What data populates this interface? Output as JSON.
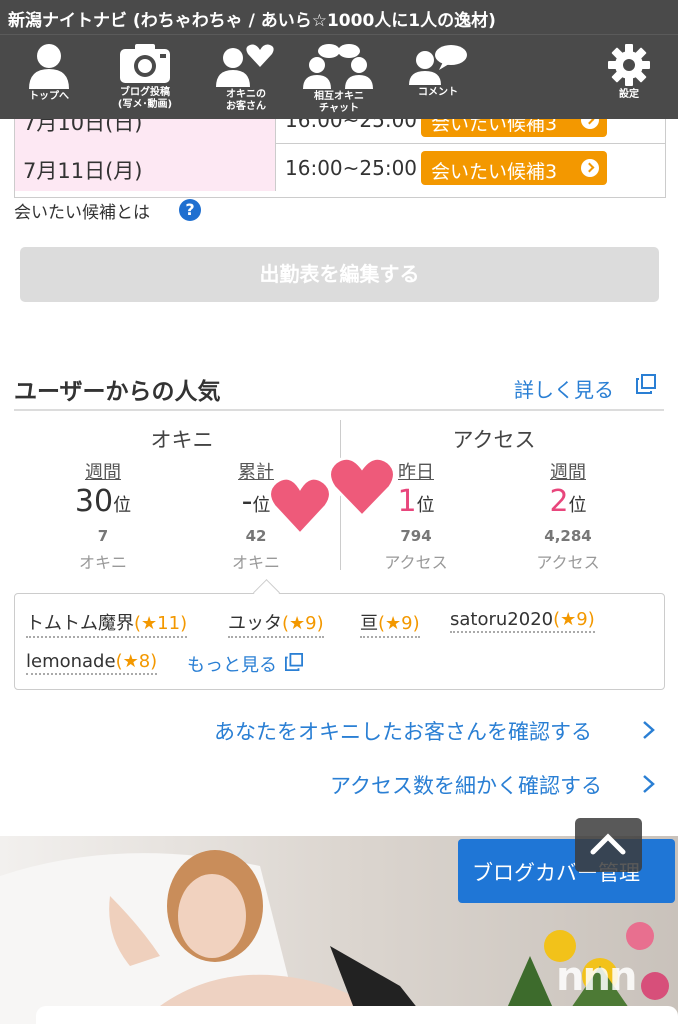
{
  "header": {
    "title": "新潟ナイトナビ (わちゃわちゃ / あいら☆1000人に1人の逸材)"
  },
  "nav": [
    {
      "label": "トップへ",
      "icon": "person-icon"
    },
    {
      "label": "ブログ投稿\n(写メ･動画)",
      "icon": "camera-icon"
    },
    {
      "label": "オキニの\nお客さん",
      "icon": "heart-people-icon"
    },
    {
      "label": "相互オキニ\nチャット",
      "icon": "chat-people-icon"
    },
    {
      "label": "コメント",
      "icon": "comment-icon"
    },
    {
      "label": "設定",
      "icon": "gear-icon"
    }
  ],
  "schedule": {
    "rows": [
      {
        "date": "7月10日(日)",
        "time": "16:00~25:00",
        "button": "会いたい候補3"
      },
      {
        "date": "7月11日(月)",
        "time": "16:00~25:00",
        "button": "会いたい候補3"
      }
    ],
    "help_text": "会いたい候補とは",
    "edit_button": "出勤表を編集する"
  },
  "popularity": {
    "title": "ユーザーからの人気",
    "more": "詳しく見る",
    "okini": {
      "label": "オキニ",
      "weekly": {
        "label": "週間",
        "rank": "30",
        "unit": "位",
        "count": "7",
        "count_label": "オキニ"
      },
      "total": {
        "label": "累計",
        "rank": "-",
        "unit": "位",
        "count": "42",
        "count_label": "オキニ"
      }
    },
    "access": {
      "label": "アクセス",
      "yesterday": {
        "label": "昨日",
        "rank": "1",
        "unit": "位",
        "count": "794",
        "count_label": "アクセス"
      },
      "weekly": {
        "label": "週間",
        "rank": "2",
        "unit": "位",
        "count": "4,284",
        "count_label": "アクセス"
      }
    }
  },
  "fans": {
    "items": [
      {
        "name": "トムトム魔界",
        "stars": "(★11)"
      },
      {
        "name": "ユッタ",
        "stars": "(★9)"
      },
      {
        "name": "亘",
        "stars": "(★9)"
      },
      {
        "name": "satoru2020",
        "stars": "(★9)"
      },
      {
        "name": "lemonade",
        "stars": "(★8)"
      }
    ],
    "more": "もっと見る"
  },
  "links": {
    "check_okini": "あなたをオキニしたお客さんを確認する",
    "check_access": "アクセス数を細かく確認する"
  },
  "blog": {
    "cover_button": "ブログカバー管理",
    "watermark": "nnn"
  },
  "colors": {
    "accent_orange": "#f39800",
    "link_blue": "#2a7fd4",
    "rank_pink": "#e8467c",
    "header_gray": "#4a4a4a",
    "date_pink": "#fde8f3"
  }
}
